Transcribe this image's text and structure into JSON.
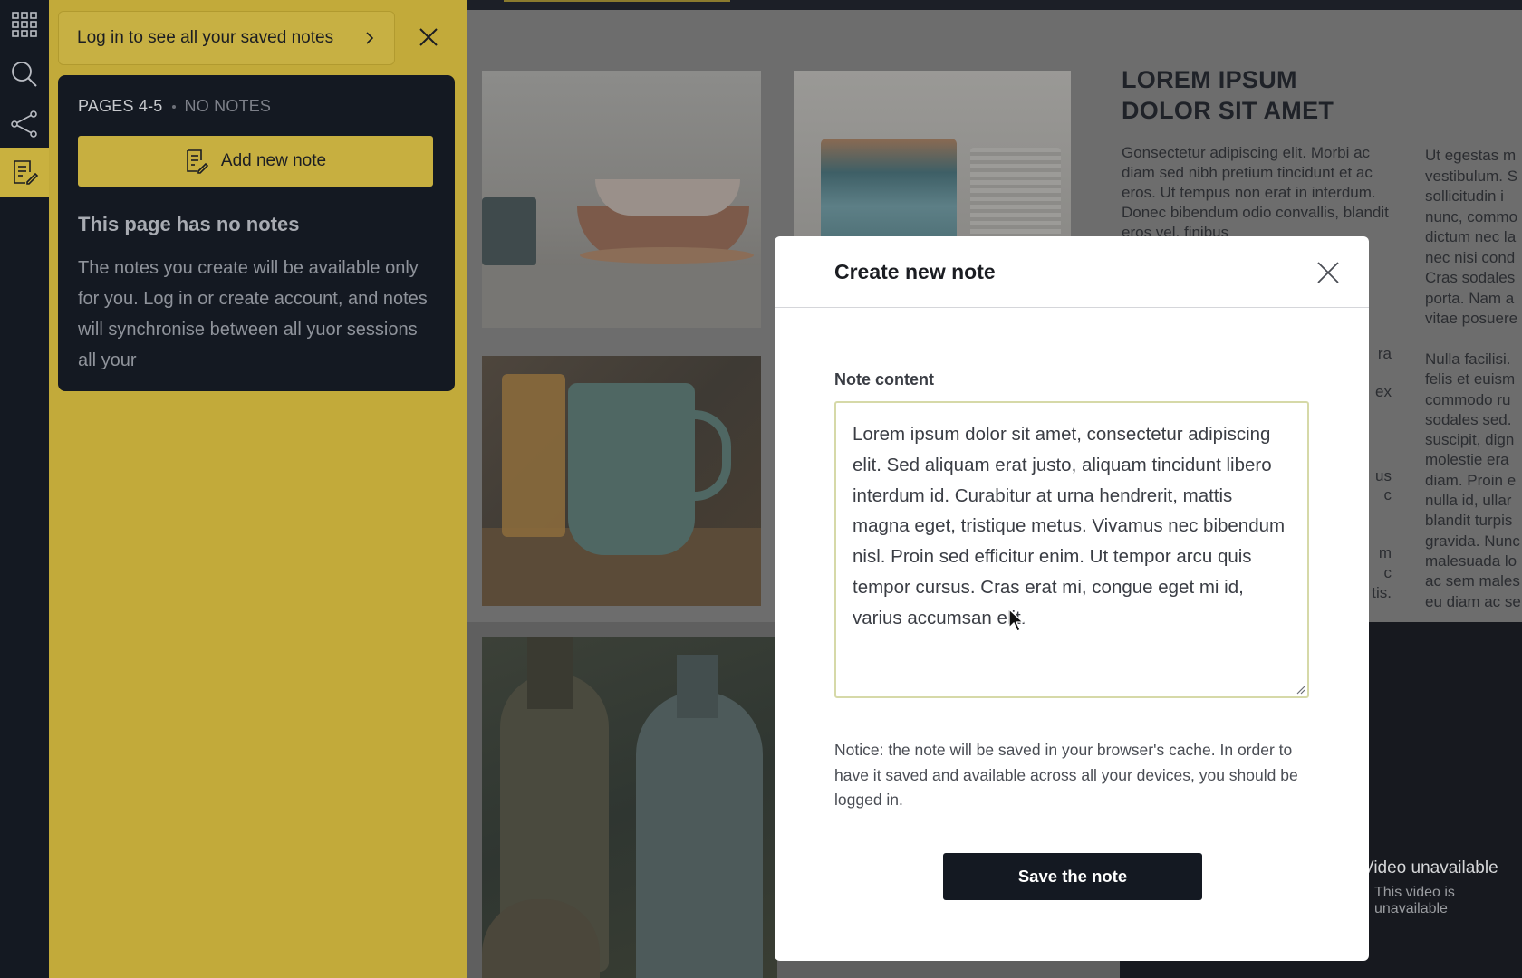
{
  "rail": {
    "icons": [
      "apps-grid-icon",
      "search-icon",
      "share-icon",
      "notes-icon"
    ],
    "active": "notes-icon"
  },
  "panel": {
    "login_prompt": "Log in to see all your saved notes",
    "pages_label": "PAGES 4-5",
    "notes_count_label": "NO NOTES",
    "add_button_label": "Add new note",
    "empty_title": "This page has no notes",
    "empty_text": "The notes you create will be available only for you. Log in or create account, and notes will synchronise between all yuor sessions all your"
  },
  "document": {
    "title": "LOREM IPSUM DOLOR SIT AMET",
    "col1_text": "Gonsectetur adipiscing elit. Morbi ac diam sed nibh pretium tincidunt et ac eros. Ut tempus non erat in interdum. Donec bibendum odio convallis, blandit eros vel, finibus",
    "col2_lines": [
      "Ut egestas m",
      "vestibulum. S",
      "sollicitudin i",
      "nunc, commo",
      "dictum nec la",
      "nec nisi cond",
      "Cras sodales",
      "porta. Nam a",
      "vitae posuere"
    ],
    "col2b_lines": [
      "Nulla facilisi.",
      "felis et euism",
      "commodo ru",
      "sodales sed.",
      "suscipit, dign",
      "molestie era",
      "diam. Proin e",
      "nulla id, ullar",
      "blandit turpis",
      "gravida. Nunc",
      "malesuada lo",
      "ac sem males",
      "eu diam ac se"
    ],
    "peek_fragments": [
      "ra",
      "ex",
      "us",
      "c",
      "m",
      "c",
      "tis."
    ],
    "video_title": "Video unavailable",
    "video_sub": "This video is unavailable"
  },
  "modal": {
    "title": "Create new note",
    "field_label": "Note content",
    "content": "Lorem ipsum dolor sit amet, consectetur adipiscing elit. Sed aliquam erat justo, aliquam tincidunt libero interdum id. Curabitur at urna hendrerit, mattis magna eget, tristique metus. Vivamus nec bibendum nisl. Proin sed efficitur enim. Ut tempor arcu quis tempor cursus. Cras erat mi, congue eget mi id, varius accumsan elit.",
    "notice": "Notice: the note will be saved in your browser's cache. In order to have it saved and available across all your devices, you should be logged in.",
    "save_label": "Save the note"
  },
  "colors": {
    "accent_yellow": "#c7af40",
    "dark_navy": "#141922"
  }
}
